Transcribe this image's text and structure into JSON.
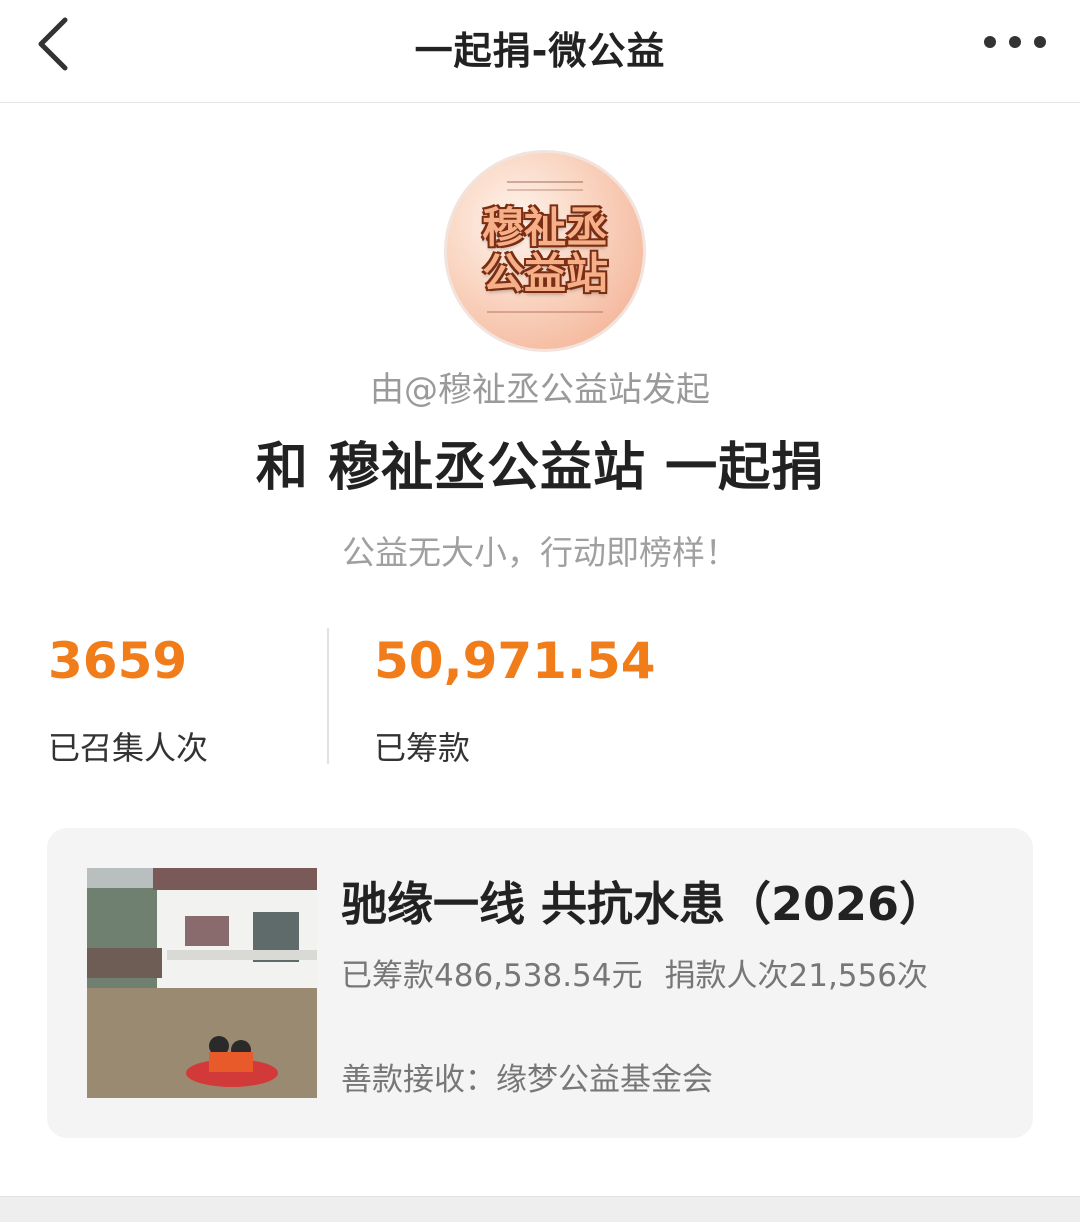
{
  "nav": {
    "title": "一起捐-微公益",
    "back_icon": "chevron-left-icon",
    "more_icon": "more-dots-icon"
  },
  "profile": {
    "avatar_text_line1": "穆祉丞",
    "avatar_text_line2": "公益站",
    "initiator": "由@穆祉丞公益站发起",
    "headline": "和 穆祉丞公益站 一起捐",
    "slogan": "公益无大小，行动即榜样！"
  },
  "stats": {
    "participants_value": "3659",
    "participants_label": "已召集人次",
    "raised_value": "50,971.54",
    "raised_label": "已筹款"
  },
  "project": {
    "title": "驰缘一线 共抗水患（2026）",
    "raised": "已筹款486,538.54元",
    "donors": "捐款人次21,556次",
    "receiver": "善款接收：缘梦公益基金会"
  },
  "colors": {
    "accent": "#f07c1a",
    "card_bg": "#f4f4f4"
  }
}
